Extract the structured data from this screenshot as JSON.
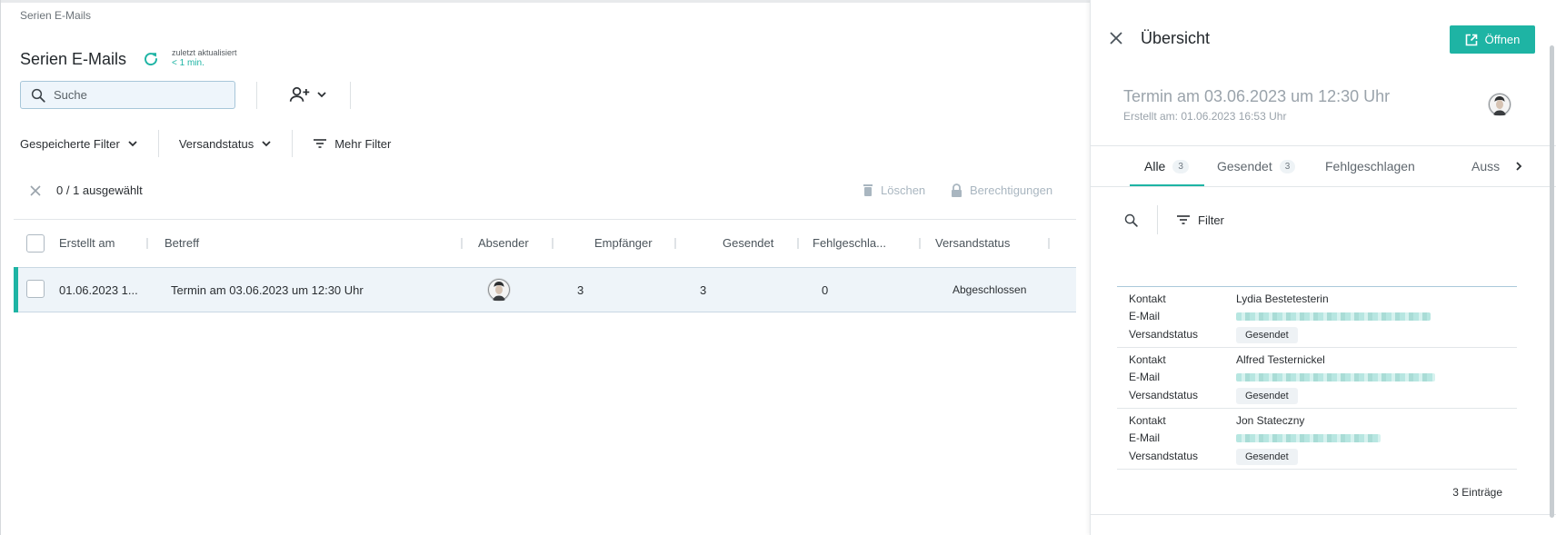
{
  "breadcrumb": "Serien E-Mails",
  "page": {
    "title": "Serien E-Mails",
    "updated_label": "zuletzt aktualisiert",
    "updated_value": "< 1 min."
  },
  "search": {
    "placeholder": "Suche"
  },
  "filters": {
    "saved": "Gespeicherte Filter",
    "status": "Versandstatus",
    "more": "Mehr Filter"
  },
  "selection": {
    "count": "0 / 1 ausgewählt",
    "delete": "Löschen",
    "permissions": "Berechtigungen"
  },
  "table": {
    "columns": [
      "Erstellt am",
      "Betreff",
      "Absender",
      "Empfänger",
      "Gesendet",
      "Fehlgeschla...",
      "Versandstatus"
    ],
    "rows": [
      {
        "created": "01.06.2023 1...",
        "subject": "Termin am 03.06.2023 um 12:30 Uhr",
        "recipients": "3",
        "sent": "3",
        "failed": "0",
        "status": "Abgeschlossen"
      }
    ]
  },
  "panel": {
    "title": "Übersicht",
    "open_label": "Öffnen",
    "subject": "Termin am 03.06.2023 um 12:30 Uhr",
    "created": "Erstellt am: 01.06.2023 16:53 Uhr",
    "tabs": [
      {
        "label": "Alle",
        "badge": "3"
      },
      {
        "label": "Gesendet",
        "badge": "3"
      },
      {
        "label": "Fehlgeschlagen"
      },
      {
        "label": "Auss"
      }
    ],
    "filter_label": "Filter",
    "field_labels": {
      "contact": "Kontakt",
      "email": "E-Mail",
      "status": "Versandstatus"
    },
    "records": [
      {
        "contact": "Lydia  Bestetesterin",
        "status": "Gesendet"
      },
      {
        "contact": "Alfred  Testernickel",
        "status": "Gesendet"
      },
      {
        "contact": "Jon  Stateczny",
        "status": "Gesendet"
      }
    ],
    "total": "3 Einträge"
  },
  "colors": {
    "accent": "#1eb4a4",
    "muted": "#a9b6c0"
  }
}
